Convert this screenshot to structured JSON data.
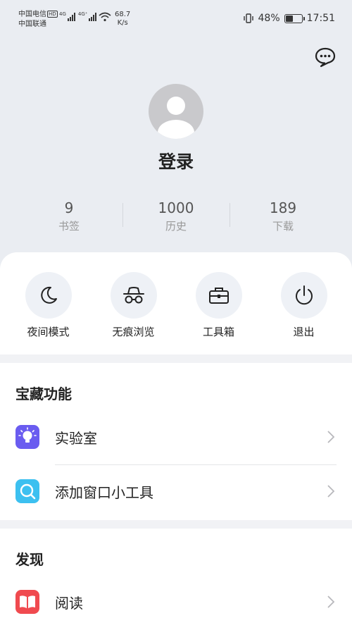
{
  "status_bar": {
    "carrier1": "中国电信",
    "carrier1_badge": "HD",
    "carrier2": "中国联通",
    "net1": "4G",
    "net2": "4G⁺",
    "speed_value": "68.7",
    "speed_unit": "K/s",
    "battery": "48%",
    "battery_level": 0.48,
    "time": "17:51"
  },
  "profile": {
    "login_label": "登录",
    "stats": [
      {
        "value": "9",
        "label": "书签"
      },
      {
        "value": "1000",
        "label": "历史"
      },
      {
        "value": "189",
        "label": "下载"
      }
    ]
  },
  "quick_actions": [
    {
      "label": "夜间模式",
      "icon": "moon-icon"
    },
    {
      "label": "无痕浏览",
      "icon": "incognito-icon"
    },
    {
      "label": "工具箱",
      "icon": "toolbox-icon"
    },
    {
      "label": "退出",
      "icon": "power-icon"
    }
  ],
  "treasure": {
    "title": "宝藏功能",
    "items": [
      {
        "label": "实验室",
        "icon": "lab-bulb-icon",
        "color": "#6a5cf0"
      },
      {
        "label": "添加窗口小工具",
        "icon": "widget-search-icon",
        "color": "#3cc0f0"
      }
    ]
  },
  "discover": {
    "title": "发现",
    "items": [
      {
        "label": "阅读",
        "icon": "book-icon",
        "color": "#f04a4f"
      }
    ]
  }
}
